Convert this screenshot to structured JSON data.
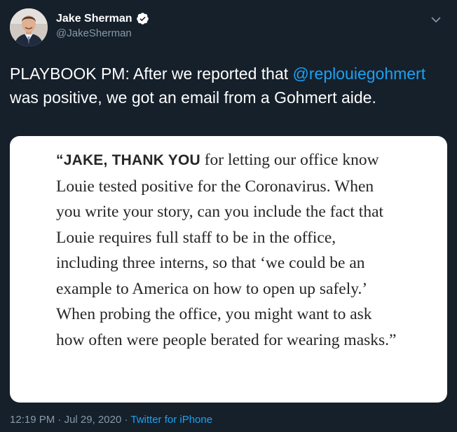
{
  "tweet": {
    "author": {
      "display_name": "Jake Sherman",
      "handle": "@JakeSherman",
      "verified": true,
      "avatar_icon": "profile-photo"
    },
    "text": {
      "prefix": "PLAYBOOK PM: After we reported that ",
      "mention": "@replouiegohmert",
      "suffix": " was positive, we got an email from a Gohmert aide."
    },
    "image": {
      "quote_lead": "“JAKE, THANK YOU",
      "quote_body": " for letting our office know Louie tested positive for the Coronavirus. When you write your story, can you include the fact that Louie requires full staff to be in the office, including three interns, so that ‘we could be an example to America on how to open up safely.’ When probing the office, you might want to ask how often were people berated for wearing masks.”"
    },
    "meta": {
      "time": "12:19 PM",
      "separator1": " · ",
      "date": "Jul 29, 2020",
      "separator2": " · ",
      "source": "Twitter for iPhone"
    }
  },
  "colors": {
    "background": "#15202b",
    "accent": "#1da1f2",
    "secondary_text": "#8899a6",
    "primary_text": "#ffffff"
  },
  "icons": {
    "verified": "verified-badge-icon",
    "caret": "chevron-down-icon"
  }
}
